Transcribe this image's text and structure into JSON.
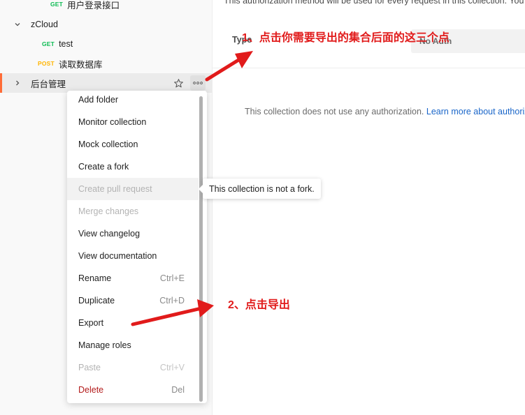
{
  "sidebar": {
    "items": [
      {
        "method": "GET",
        "label": "用户登录接口"
      },
      {
        "label": "zCloud"
      },
      {
        "method": "GET",
        "label": "test"
      },
      {
        "method": "POST",
        "label": "读取数据库"
      },
      {
        "label": "后台管理"
      }
    ]
  },
  "main": {
    "auth_desc": "This authorization method will be used for every request in this collection. You",
    "type_label": "Type",
    "type_value": "No Auth",
    "no_auth_text": "This collection does not use any authorization. ",
    "learn_more": "Learn more about authorization"
  },
  "menu": {
    "items": [
      {
        "label": "Add folder",
        "shortcut": ""
      },
      {
        "label": "Monitor collection",
        "shortcut": ""
      },
      {
        "label": "Mock collection",
        "shortcut": ""
      },
      {
        "label": "Create a fork",
        "shortcut": ""
      },
      {
        "label": "Create pull request",
        "shortcut": ""
      },
      {
        "label": "Merge changes",
        "shortcut": ""
      },
      {
        "label": "View changelog",
        "shortcut": ""
      },
      {
        "label": "View documentation",
        "shortcut": ""
      },
      {
        "label": "Rename",
        "shortcut": "Ctrl+E"
      },
      {
        "label": "Duplicate",
        "shortcut": "Ctrl+D"
      },
      {
        "label": "Export",
        "shortcut": ""
      },
      {
        "label": "Manage roles",
        "shortcut": ""
      },
      {
        "label": "Paste",
        "shortcut": "Ctrl+V"
      },
      {
        "label": "Delete",
        "shortcut": "Del"
      }
    ]
  },
  "tooltip": {
    "text": "This collection is not a fork."
  },
  "annotations": {
    "step1": "1、点击你需要导出的集合后面的这三个点",
    "step2": "2、点击导出"
  },
  "colors": {
    "accent": "#ff6c37",
    "get": "#0cbb52",
    "post": "#ffb400",
    "annotation": "#e11b1b",
    "link": "#1a66c9"
  }
}
